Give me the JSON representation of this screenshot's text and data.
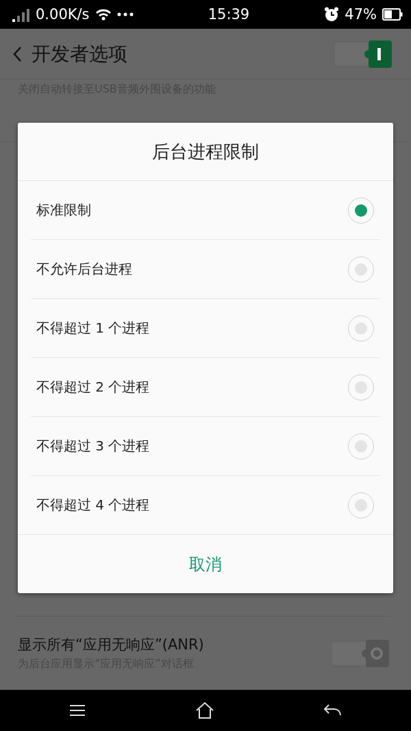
{
  "status_bar": {
    "speed": "0.00K/s",
    "time": "15:39",
    "battery": "47%"
  },
  "header": {
    "title": "开发者选项",
    "switch_on": true
  },
  "background_rows": [
    {
      "subtitle": "关闭自动转接至USB音频外围设备的功能"
    },
    {
      "title": "显示所有“应用无响应”(ANR)",
      "subtitle": "为后台应用显示“应用无响应”对话框",
      "on": false
    }
  ],
  "dialog": {
    "title": "后台进程限制",
    "options": [
      {
        "label": "标准限制",
        "selected": true
      },
      {
        "label": "不允许后台进程",
        "selected": false
      },
      {
        "label": "不得超过 1 个进程",
        "selected": false
      },
      {
        "label": "不得超过 2 个进程",
        "selected": false
      },
      {
        "label": "不得超过 3 个进程",
        "selected": false
      },
      {
        "label": "不得超过 4 个进程",
        "selected": false
      }
    ],
    "cancel": "取消"
  }
}
